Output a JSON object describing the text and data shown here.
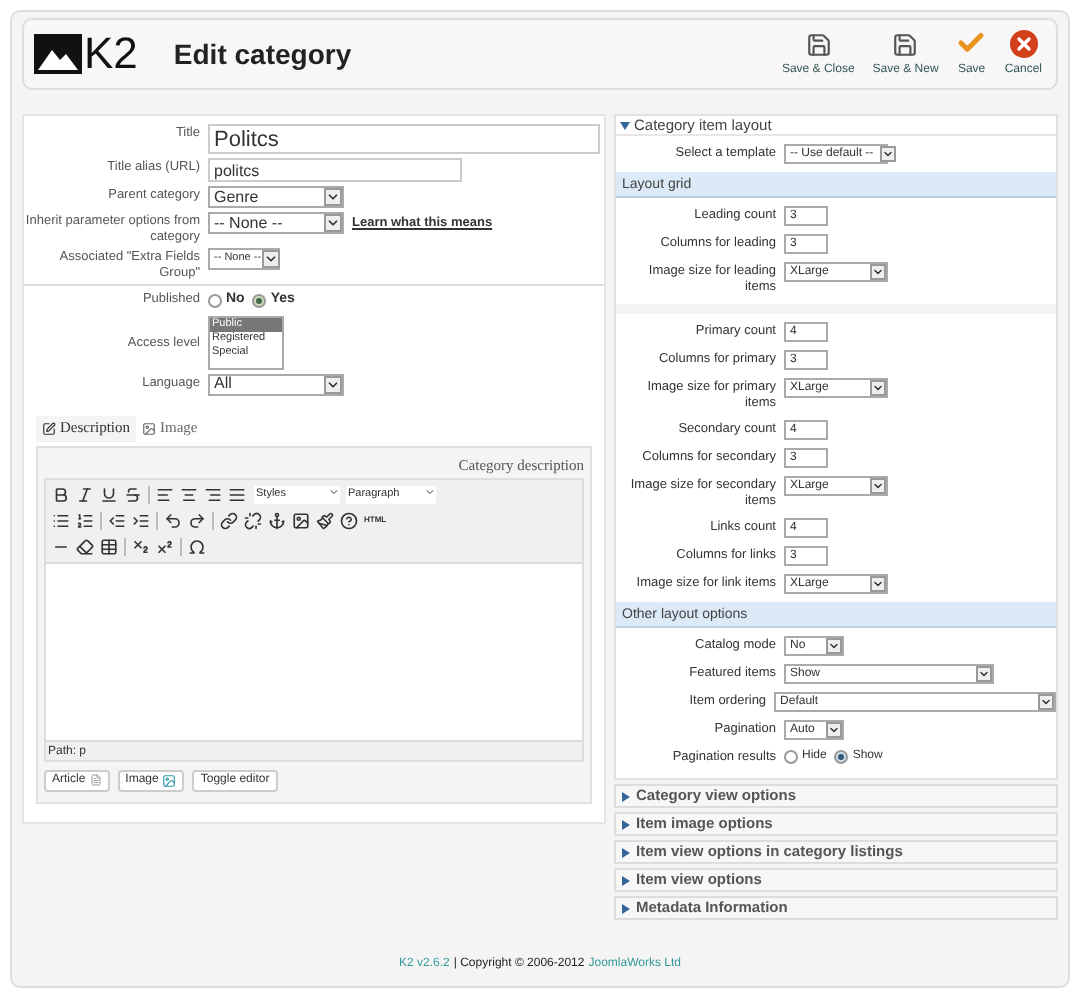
{
  "header": {
    "logo_text": "K2",
    "title": "Edit category",
    "toolbar": [
      {
        "kind": "save",
        "label": "Save & Close"
      },
      {
        "kind": "save",
        "label": "Save & New"
      },
      {
        "kind": "apply",
        "label": "Save"
      },
      {
        "kind": "cancel",
        "label": "Cancel"
      }
    ]
  },
  "form": {
    "fields": [
      {
        "kind": "title",
        "label": "Title",
        "value": "Politcs"
      },
      {
        "kind": "text",
        "label": "Title alias (URL)",
        "value": "politcs"
      },
      {
        "kind": "select",
        "label": "Parent category",
        "value": "Genre"
      },
      {
        "kind": "select",
        "label": "Inherit parameter options from category",
        "value": "-- None --",
        "link": "Learn what this means"
      },
      {
        "kind": "select",
        "label": "Associated \"Extra Fields Group\"",
        "value": "-- None --"
      },
      {
        "kind": "radio",
        "label": "Published",
        "options": [
          {
            "label": "No",
            "selected": false
          },
          {
            "label": "Yes",
            "selected": true
          }
        ]
      },
      {
        "kind": "listbox",
        "label": "Access level",
        "options": [
          {
            "label": "Public",
            "selected": true
          },
          {
            "label": "Registered",
            "selected": false
          },
          {
            "label": "Special",
            "selected": false
          }
        ]
      },
      {
        "kind": "select",
        "label": "Language",
        "value": "All"
      }
    ]
  },
  "editor": {
    "tabs": [
      {
        "label": "Description",
        "selected": true
      },
      {
        "label": "Image",
        "selected": false
      }
    ],
    "heading": "Category description",
    "styles": "Styles",
    "format": "Paragraph",
    "html_label": "HTML",
    "path": "Path: p",
    "buttons": [
      {
        "kind": "article",
        "label": "Article"
      },
      {
        "kind": "image",
        "label": "Image"
      },
      {
        "kind": "plain",
        "label": "Toggle editor"
      }
    ]
  },
  "item_layout": {
    "title": "Category item layout",
    "expanded": true,
    "template": {
      "kind": "select",
      "label": "Select a template",
      "value": "-- Use default --"
    },
    "layout_grid": {
      "title": "Layout grid",
      "groups": [
        {
          "fields": [
            {
              "kind": "text",
              "label": "Leading count",
              "value": "3"
            },
            {
              "kind": "text",
              "label": "Columns for leading",
              "value": "3"
            },
            {
              "kind": "select",
              "label": "Image size for leading items",
              "value": "XLarge"
            }
          ]
        },
        {
          "fields": [
            {
              "kind": "text",
              "label": "Primary count",
              "value": "4"
            },
            {
              "kind": "text",
              "label": "Columns for primary",
              "value": "3"
            },
            {
              "kind": "select",
              "label": "Image size for primary items",
              "value": "XLarge"
            },
            {
              "kind": "text",
              "label": "Secondary count",
              "value": "4"
            },
            {
              "kind": "text",
              "label": "Columns for secondary",
              "value": "3"
            },
            {
              "kind": "select",
              "label": "Image size for secondary items",
              "value": "XLarge"
            },
            {
              "kind": "text",
              "label": "Links count",
              "value": "4"
            },
            {
              "kind": "text",
              "label": "Columns for links",
              "value": "3"
            },
            {
              "kind": "select",
              "label": "Image size for link items",
              "value": "XLarge"
            }
          ]
        }
      ]
    },
    "other": {
      "title": "Other layout options",
      "fields": [
        {
          "kind": "select",
          "label": "Catalog mode",
          "value": "No"
        },
        {
          "kind": "select",
          "label": "Featured items",
          "value": "Show"
        },
        {
          "kind": "select",
          "label": "Item ordering",
          "value": "Default"
        },
        {
          "kind": "select",
          "label": "Pagination",
          "value": "Auto"
        },
        {
          "kind": "radio",
          "label": "Pagination results",
          "options": [
            {
              "label": "Hide",
              "selected": false
            },
            {
              "label": "Show",
              "selected": true
            }
          ]
        }
      ]
    }
  },
  "collapsed_sections": [
    {
      "title": "Category view options",
      "expanded": false
    },
    {
      "title": "Item image options",
      "expanded": false
    },
    {
      "title": "Item view options in category listings",
      "expanded": false
    },
    {
      "title": "Item view options",
      "expanded": false
    },
    {
      "title": "Metadata Information",
      "expanded": false
    }
  ],
  "footer": {
    "version": "K2 v2.6.2",
    "copyright": "| Copyright © 2006-2012",
    "company": "JoomlaWorks Ltd"
  }
}
